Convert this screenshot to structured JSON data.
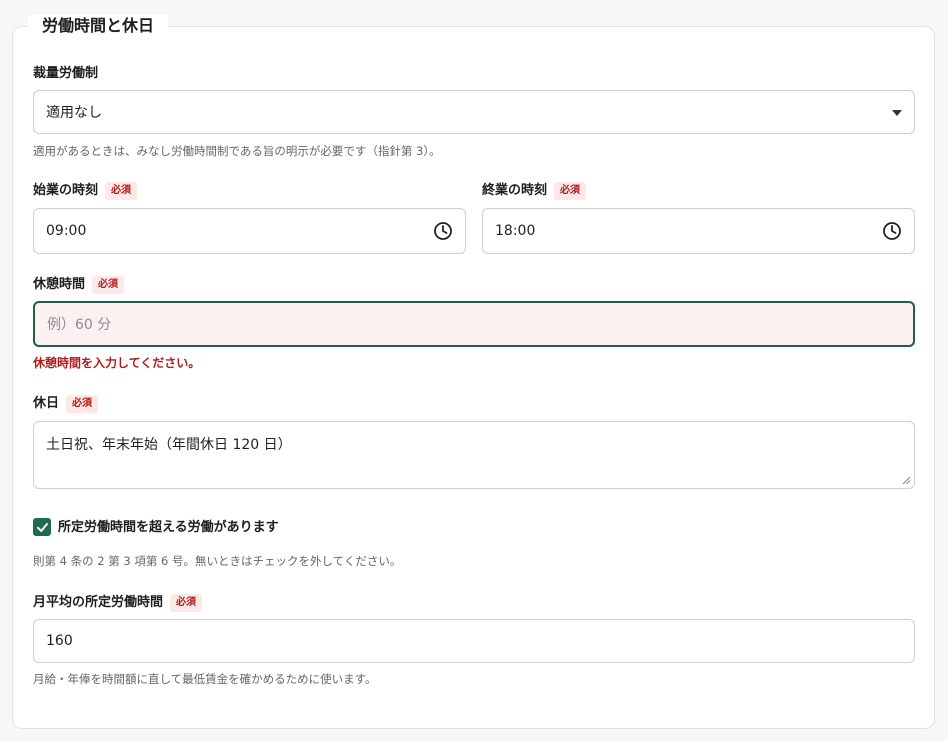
{
  "section": {
    "title": "労働時間と休日"
  },
  "discretionary": {
    "label": "裁量労働制",
    "value": "適用なし",
    "help": "適用があるときは、みなし労働時間制である旨の明示が必要です（指針第 3）。"
  },
  "required_badge": "必須",
  "start_time": {
    "label": "始業の時刻",
    "value": "09:00"
  },
  "end_time": {
    "label": "終業の時刻",
    "value": "18:00"
  },
  "break_time": {
    "label": "休憩時間",
    "placeholder": "例）60 分",
    "error": "休憩時間を入力してください。"
  },
  "holidays": {
    "label": "休日",
    "value": "土日祝、年末年始（年間休日 120 日）"
  },
  "overtime": {
    "checked": true,
    "label": "所定労働時間を超える労働があります",
    "help": "則第 4 条の 2 第 3 項第 6 号。無いときはチェックを外してください。"
  },
  "monthly_hours": {
    "label": "月平均の所定労働時間",
    "value": "160",
    "help": "月給・年俸を時間額に直して最低賃金を確かめるために使います。"
  }
}
